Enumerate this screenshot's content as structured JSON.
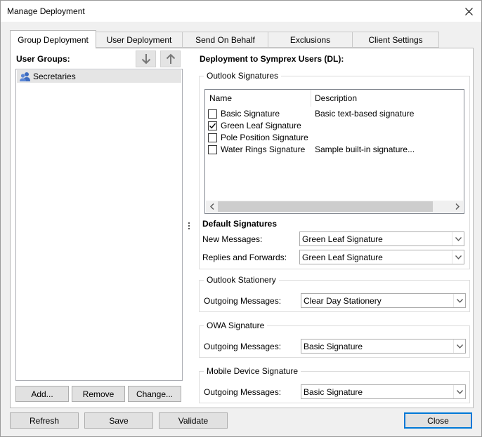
{
  "window": {
    "title": "Manage Deployment"
  },
  "tabs": [
    {
      "label": "Group Deployment",
      "active": true
    },
    {
      "label": "User Deployment",
      "active": false
    },
    {
      "label": "Send On Behalf",
      "active": false
    },
    {
      "label": "Exclusions",
      "active": false
    },
    {
      "label": "Client Settings",
      "active": false
    }
  ],
  "left": {
    "heading": "User Groups:",
    "groups": [
      "Secretaries"
    ],
    "buttons": {
      "add": "Add...",
      "remove": "Remove",
      "change": "Change..."
    }
  },
  "right": {
    "heading": "Deployment to Symprex Users (DL):",
    "outlook_signatures": {
      "title": "Outlook Signatures",
      "columns": {
        "name": "Name",
        "description": "Description"
      },
      "rows": [
        {
          "name": "Basic Signature",
          "description": "Basic text-based signature",
          "checked": false
        },
        {
          "name": "Green Leaf Signature",
          "description": "",
          "checked": true
        },
        {
          "name": "Pole Position Signature",
          "description": "",
          "checked": false
        },
        {
          "name": "Water Rings Signature",
          "description": "Sample built-in signature...",
          "checked": false
        }
      ]
    },
    "default_signatures": {
      "heading": "Default Signatures",
      "new_messages": {
        "label": "New Messages:",
        "value": "Green Leaf Signature"
      },
      "replies_forwards": {
        "label": "Replies and Forwards:",
        "value": "Green Leaf Signature"
      }
    },
    "outlook_stationery": {
      "title": "Outlook Stationery",
      "outgoing": {
        "label": "Outgoing Messages:",
        "value": "Clear Day Stationery"
      }
    },
    "owa_signature": {
      "title": "OWA Signature",
      "outgoing": {
        "label": "Outgoing Messages:",
        "value": "Basic Signature"
      }
    },
    "mobile_signature": {
      "title": "Mobile Device Signature",
      "outgoing": {
        "label": "Outgoing Messages:",
        "value": "Basic Signature"
      }
    }
  },
  "bottom": {
    "refresh": "Refresh",
    "save": "Save",
    "validate": "Validate",
    "close": "Close"
  },
  "colors": {
    "accent": "#0078d7",
    "group_icon": "#3d6cc0",
    "selection": "#e5e5e5"
  }
}
